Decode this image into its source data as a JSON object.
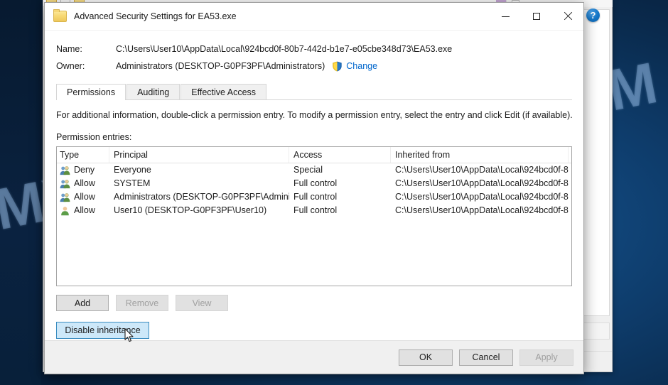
{
  "window": {
    "title": "Advanced Security Settings for EA53.exe",
    "folder_icon": "folder-icon",
    "minimize_label": "Minimize",
    "maximize_label": "Maximize",
    "close_label": "Close"
  },
  "help": {
    "glyph": "?",
    "label": "Help"
  },
  "watermark": {
    "text": "MYANTISPYWARE.COM"
  },
  "info": {
    "name_label": "Name:",
    "name_value": "C:\\Users\\User10\\AppData\\Local\\924bcd0f-80b7-442d-b1e7-e05cbe348d73\\EA53.exe",
    "owner_label": "Owner:",
    "owner_value": "Administrators (DESKTOP-G0PF3PF\\Administrators)",
    "change_link": "Change",
    "shield_icon": "uac-shield-icon"
  },
  "tabs": [
    {
      "label": "Permissions",
      "active": true
    },
    {
      "label": "Auditing",
      "active": false
    },
    {
      "label": "Effective Access",
      "active": false
    }
  ],
  "panel": {
    "hint": "For additional information, double-click a permission entry. To modify a permission entry, select the entry and click Edit (if available).",
    "entries_label": "Permission entries:"
  },
  "table": {
    "columns": [
      "Type",
      "Principal",
      "Access",
      "Inherited from"
    ],
    "rows": [
      {
        "icon": "group-icon",
        "type": "Deny",
        "principal": "Everyone",
        "access": "Special",
        "inherited": "C:\\Users\\User10\\AppData\\Local\\924bcd0f-8..."
      },
      {
        "icon": "group-icon",
        "type": "Allow",
        "principal": "SYSTEM",
        "access": "Full control",
        "inherited": "C:\\Users\\User10\\AppData\\Local\\924bcd0f-8..."
      },
      {
        "icon": "group-icon",
        "type": "Allow",
        "principal": "Administrators (DESKTOP-G0PF3PF\\Admini...",
        "access": "Full control",
        "inherited": "C:\\Users\\User10\\AppData\\Local\\924bcd0f-8..."
      },
      {
        "icon": "user-icon",
        "type": "Allow",
        "principal": "User10 (DESKTOP-G0PF3PF\\User10)",
        "access": "Full control",
        "inherited": "C:\\Users\\User10\\AppData\\Local\\924bcd0f-8..."
      }
    ]
  },
  "mid_buttons": [
    {
      "label": "Add",
      "disabled": false
    },
    {
      "label": "Remove",
      "disabled": true
    },
    {
      "label": "View",
      "disabled": true
    }
  ],
  "inherit_button": {
    "label": "Disable inheritance",
    "state": "hover"
  },
  "footer_buttons": [
    {
      "label": "OK",
      "disabled": false
    },
    {
      "label": "Cancel",
      "disabled": false
    },
    {
      "label": "Apply",
      "disabled": true
    }
  ],
  "colors": {
    "accent": "#0078d7",
    "link": "#0066cc",
    "hover_fill": "#cde8f9",
    "hover_border": "#3a8cc0",
    "desktop": "#0e3c6b"
  }
}
